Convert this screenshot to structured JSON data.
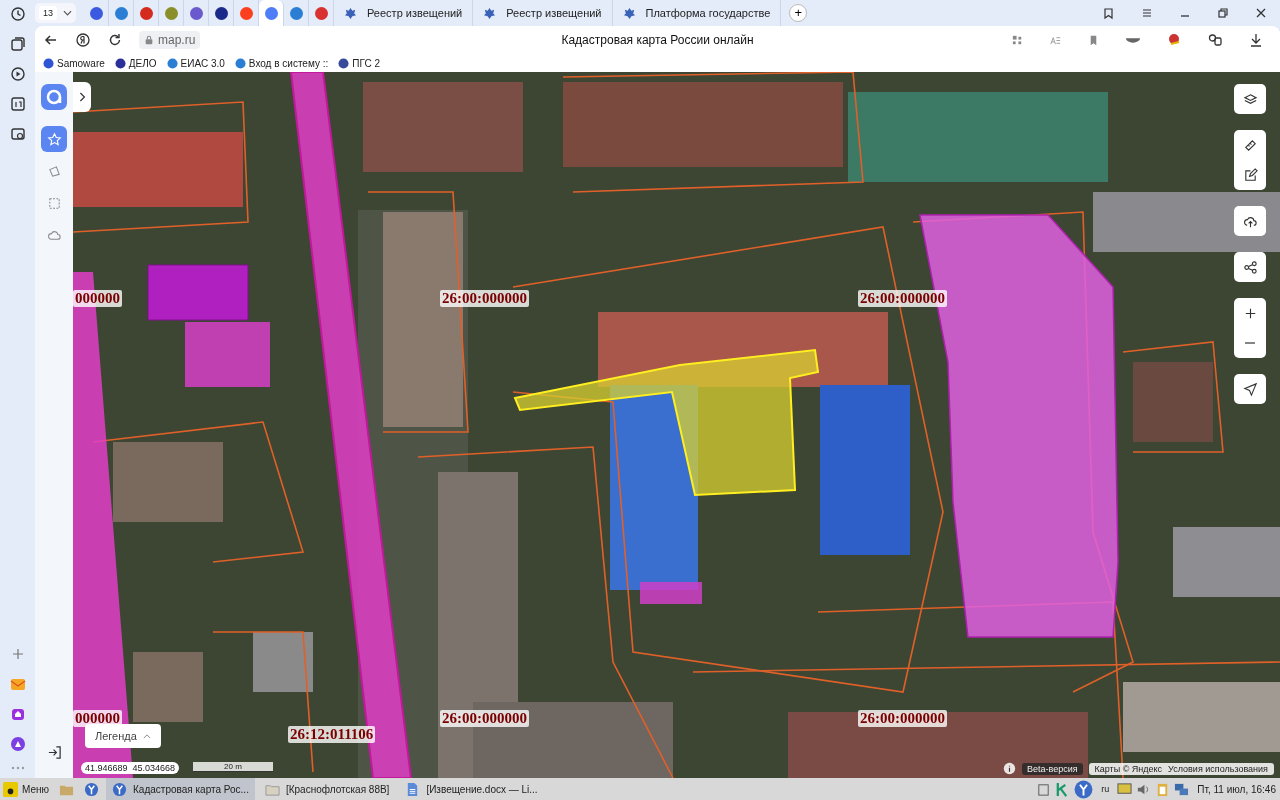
{
  "browser": {
    "tab_count": "13",
    "pinned_tabs": [
      {
        "color": "#3a5be0",
        "selected": false
      },
      {
        "color": "#2a7fd4",
        "selected": false
      },
      {
        "color": "#d52b1e",
        "selected": false
      },
      {
        "color": "#8a8f2a",
        "selected": false
      },
      {
        "color": "#6a5acd",
        "selected": false
      },
      {
        "color": "#1b2a8a",
        "selected": false
      },
      {
        "color": "#fc3f1d",
        "selected": false
      },
      {
        "color": "#4f7cf7",
        "selected": true
      },
      {
        "color": "#2a7fd4",
        "selected": false
      },
      {
        "color": "#d93030",
        "selected": false
      }
    ],
    "tabs": [
      {
        "title": "Реестр извещений",
        "selected": false
      },
      {
        "title": "Реестр извещений",
        "selected": false
      },
      {
        "title": "Платформа государстве",
        "selected": false
      }
    ],
    "new_tab": "+",
    "domain": "map.ru",
    "page_title": "Кадастровая карта России онлайн",
    "bookmarks": [
      {
        "label": "Samoware",
        "color": "#2f55d4"
      },
      {
        "label": "ДЕЛО",
        "color": "#2a2f9a"
      },
      {
        "label": "ЕИАС 3.0",
        "color": "#2a7fd4"
      },
      {
        "label": "Вход в систему ::",
        "color": "#2a7fd4"
      },
      {
        "label": "ПГС 2",
        "color": "#3a4a9a"
      }
    ]
  },
  "app": {
    "tools": [
      {
        "selected": true
      },
      {
        "selected": false
      },
      {
        "selected": false
      },
      {
        "selected": false
      }
    ],
    "map": {
      "labels": [
        "000000",
        "26:00:000000",
        "26:00:000000",
        "000000",
        "26:00:000000",
        "26:12:011106",
        "26:00:000000"
      ],
      "legend": "Легенда",
      "coordinates": "41.946689  45.034668",
      "scale": "20 m",
      "beta": "Beta-версия",
      "copyright": "Карты © Яндекс",
      "terms": "Условия использования"
    }
  },
  "taskbar": {
    "menu": "Меню",
    "windows": [
      {
        "title": "Кадастровая карта Рос...",
        "selected": true
      },
      {
        "title": "[Краснофлотская 88В]",
        "selected": false
      },
      {
        "title": "[Извещение.docx — Li...",
        "selected": false
      }
    ],
    "language": "ru",
    "clock": "Пт, 11 июл, 16:46"
  }
}
